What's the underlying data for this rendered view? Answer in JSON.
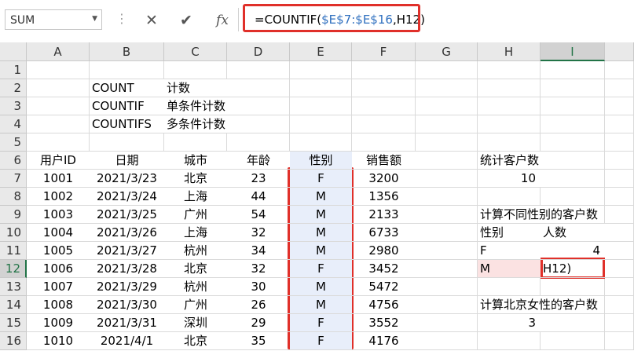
{
  "formula_bar": {
    "name_box": "SUM",
    "cancel_glyph": "✕",
    "enter_glyph": "✔",
    "fx_glyph": "fx",
    "formula_prefix": "=COUNTIF(",
    "formula_ref": "$E$7:$E$16",
    "formula_sep": ",",
    "formula_arg": "H12",
    "formula_suffix": ")"
  },
  "columns": [
    "A",
    "B",
    "C",
    "D",
    "E",
    "F",
    "G",
    "H",
    "I"
  ],
  "selected_column": "I",
  "rows": [
    "1",
    "2",
    "3",
    "4",
    "5",
    "6",
    "7",
    "8",
    "9",
    "10",
    "11",
    "12",
    "13",
    "14",
    "15",
    "16"
  ],
  "selected_row": "12",
  "functions": [
    {
      "name": "COUNT",
      "desc": "计数"
    },
    {
      "name": "COUNTIF",
      "desc": "单条件计数"
    },
    {
      "name": "COUNTIFS",
      "desc": "多条件计数"
    }
  ],
  "table": {
    "headers": [
      "用户ID",
      "日期",
      "城市",
      "年龄",
      "性别",
      "销售额"
    ],
    "rows": [
      [
        "1001",
        "2021/3/23",
        "北京",
        "23",
        "F",
        "3200"
      ],
      [
        "1002",
        "2021/3/24",
        "上海",
        "44",
        "M",
        "1356"
      ],
      [
        "1003",
        "2021/3/25",
        "广州",
        "54",
        "M",
        "2133"
      ],
      [
        "1004",
        "2021/3/26",
        "上海",
        "32",
        "M",
        "6733"
      ],
      [
        "1005",
        "2021/3/27",
        "杭州",
        "34",
        "M",
        "2980"
      ],
      [
        "1006",
        "2021/3/28",
        "北京",
        "32",
        "F",
        "3452"
      ],
      [
        "1007",
        "2021/3/29",
        "杭州",
        "30",
        "M",
        "5472"
      ],
      [
        "1008",
        "2021/3/30",
        "广州",
        "26",
        "M",
        "4756"
      ],
      [
        "1009",
        "2021/3/31",
        "深圳",
        "29",
        "F",
        "3552"
      ],
      [
        "1010",
        "2021/4/1",
        "北京",
        "35",
        "F",
        "4176"
      ]
    ]
  },
  "side": {
    "total_label": "统计客户数",
    "total_value": "10",
    "gender_title": "计算不同性别的客户数",
    "gender_hdr": "性别",
    "count_hdr": "人数",
    "f_label": "F",
    "f_count": "4",
    "m_label": "M",
    "m_editing": "H12)",
    "bj_title": "计算北京女性的客户数",
    "bj_value": "3"
  },
  "colors": {
    "highlight": "#e0302a",
    "gender_fill": "#e8eefa",
    "ref_fill": "#fbe2e2",
    "formula_ref": "#2e6fbf"
  }
}
